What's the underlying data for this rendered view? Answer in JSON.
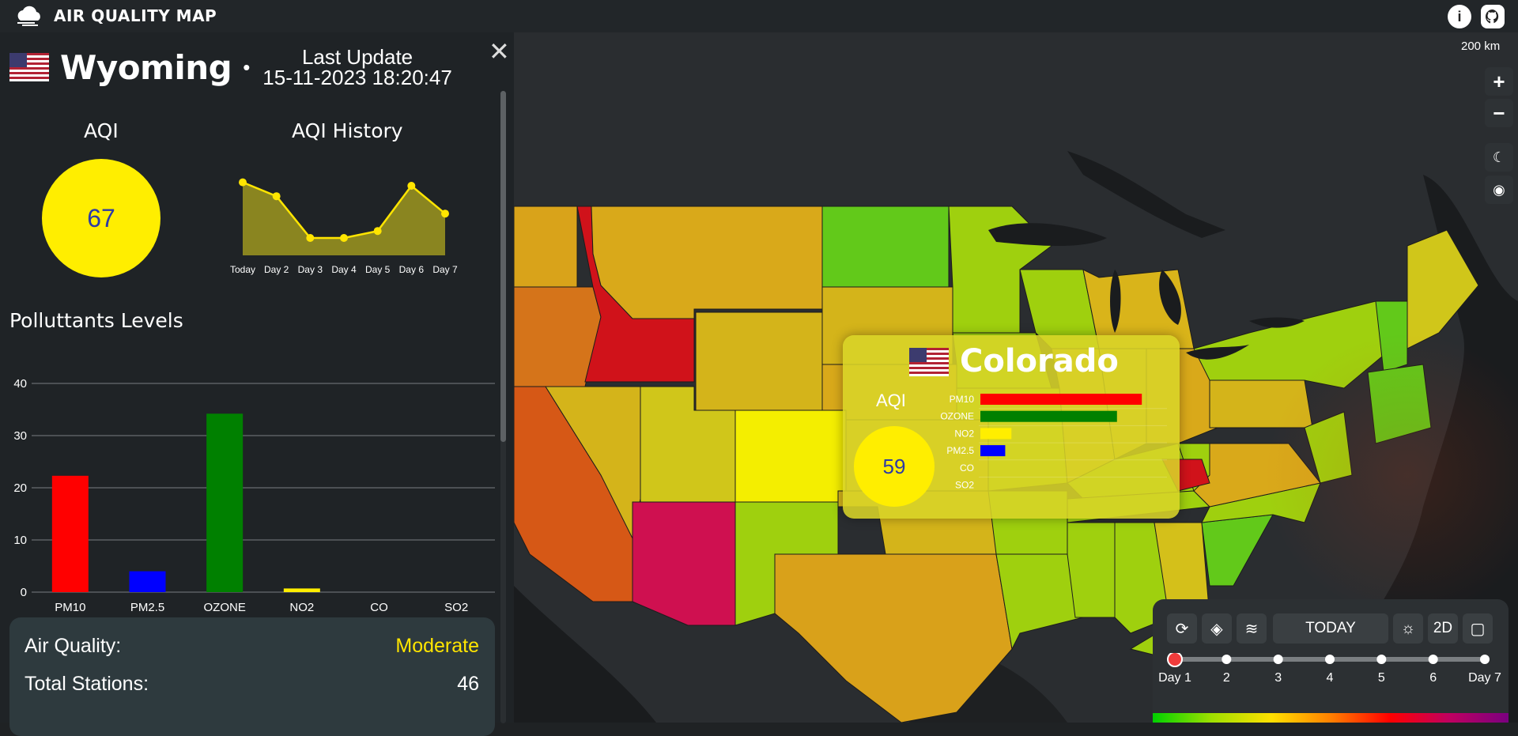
{
  "app": {
    "title": "AIR QUALITY MAP"
  },
  "panel": {
    "state_name": "Wyoming",
    "last_update_label": "Last Update",
    "last_update_value": "15-11-2023 18:20:47",
    "aqi_title": "AQI",
    "aqi_value": "67",
    "history_title": "AQI History",
    "pollutants_title": "Polluttants Levels",
    "air_quality_label": "Air Quality:",
    "air_quality_value": "Moderate",
    "stations_label": "Total Stations:",
    "stations_value": "46"
  },
  "chart_data": [
    {
      "type": "area",
      "title": "AQI History",
      "categories": [
        "Today",
        "Day 2",
        "Day 3",
        "Day 4",
        "Day 5",
        "Day 6",
        "Day 7"
      ],
      "values": [
        76,
        72,
        60,
        60,
        62,
        75,
        67
      ],
      "ylim": [
        55,
        80
      ],
      "color": "#ffe500"
    },
    {
      "type": "bar",
      "title": "Polluttants Levels",
      "categories": [
        "PM10",
        "PM2.5",
        "OZONE",
        "NO2",
        "CO",
        "SO2"
      ],
      "values": [
        22.3,
        4,
        34.2,
        0.7,
        0,
        0
      ],
      "colors": [
        "#ff0000",
        "#0000ff",
        "#008000",
        "#ffee00",
        "#888888",
        "#888888"
      ],
      "ylim": [
        0,
        40
      ],
      "yticks": [
        0,
        10,
        20,
        30,
        40
      ],
      "grid": true
    },
    {
      "type": "bar",
      "orientation": "horizontal",
      "title": "Colorado",
      "categories": [
        "PM10",
        "OZONE",
        "NO2",
        "PM2.5",
        "CO",
        "SO2"
      ],
      "values": [
        26,
        22,
        5,
        4,
        0,
        0
      ],
      "colors": [
        "#ff0000",
        "#008000",
        "#ffee00",
        "#0000ff",
        "#888888",
        "#888888"
      ],
      "xlim": [
        0,
        100
      ]
    }
  ],
  "popup": {
    "state_name": "Colorado",
    "aqi_label": "AQI",
    "aqi_value": "59"
  },
  "map": {
    "scale_label": "200 km",
    "zoom_in": "+",
    "zoom_out": "−",
    "colors": {
      "red": "#d0121a",
      "magenta": "#cf1050",
      "orange": "#d5741a",
      "amber": "#d9a11a",
      "mustard": "#d4b41a",
      "yellow": "#f4ee00",
      "lime": "#9fd00e",
      "green": "#62c91a"
    }
  },
  "controls": {
    "today_label": "TODAY",
    "view_mode": "2D",
    "timeline": [
      "Day 1",
      "2",
      "3",
      "4",
      "5",
      "6",
      "Day 7"
    ],
    "selected_day": 0
  }
}
